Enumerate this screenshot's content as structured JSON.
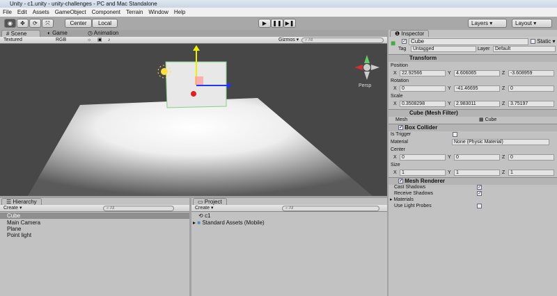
{
  "window": {
    "title": "Unity - c1.unity - unity-challenges - PC and Mac Standalone"
  },
  "menu": [
    "File",
    "Edit",
    "Assets",
    "GameObject",
    "Component",
    "Terrain",
    "Window",
    "Help"
  ],
  "toolbar": {
    "pivot": "Center",
    "space": "Local",
    "layers": "Layers",
    "layout": "Layout",
    "play": "▶",
    "pause": "❚❚",
    "step": "▶❚"
  },
  "scene": {
    "tabs": [
      "Scene",
      "Game",
      "Animation"
    ],
    "shading": "Textured",
    "render_mode": "RGB",
    "gizmos": "Gizmos",
    "search_placeholder": "All",
    "persp": "Persp"
  },
  "hierarchy": {
    "title": "Hierarchy",
    "create": "Create",
    "search_placeholder": "All",
    "items": [
      "Cube",
      "Main Camera",
      "Plane",
      "Point light"
    ]
  },
  "project": {
    "title": "Project",
    "create": "Create",
    "search_placeholder": "All",
    "items": [
      "c1",
      "Standard Assets (Mobile)"
    ]
  },
  "inspector": {
    "title": "Inspector",
    "object_name": "Cube",
    "static_label": "Static",
    "tag_label": "Tag",
    "tag": "Untagged",
    "layer_label": "Layer",
    "layer": "Default",
    "transform": {
      "title": "Transform",
      "position_label": "Position",
      "rotation_label": "Rotation",
      "scale_label": "Scale",
      "position": [
        "22.92566",
        "4.606065",
        "-3.608959"
      ],
      "rotation": [
        "0",
        "-41.46695",
        "0"
      ],
      "scale": [
        "0.3508298",
        "2.983011",
        "3.75197"
      ]
    },
    "mesh_filter": {
      "title": "Cube (Mesh Filter)",
      "mesh_label": "Mesh",
      "mesh": "Cube"
    },
    "box_collider": {
      "title": "Box Collider",
      "is_trigger_label": "Is Trigger",
      "is_trigger": false,
      "material_label": "Material",
      "material": "None (Physic Material)",
      "center_label": "Center",
      "center": [
        "0",
        "0",
        "0"
      ],
      "size_label": "Size",
      "size": [
        "1",
        "1",
        "1"
      ]
    },
    "mesh_renderer": {
      "title": "Mesh Renderer",
      "cast_shadows_label": "Cast Shadows",
      "cast_shadows": true,
      "receive_shadows_label": "Receive Shadows",
      "receive_shadows": true,
      "materials_label": "Materials",
      "light_probes_label": "Use Light Probes",
      "light_probes": false
    },
    "axes": [
      "X",
      "Y",
      "Z"
    ]
  }
}
